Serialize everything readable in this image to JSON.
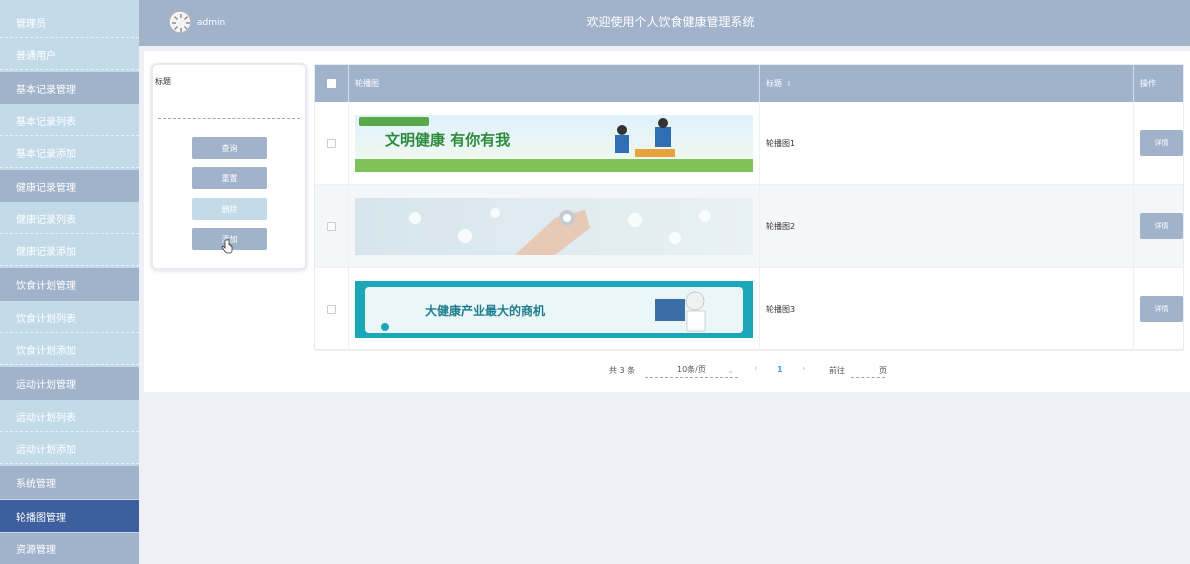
{
  "sidebar": {
    "items": [
      {
        "label": "管理员",
        "kind": "sub"
      },
      {
        "label": "普通用户",
        "kind": "sub"
      },
      {
        "label": "基本记录管理",
        "kind": "header"
      },
      {
        "label": "基本记录列表",
        "kind": "sub"
      },
      {
        "label": "基本记录添加",
        "kind": "sub"
      },
      {
        "label": "健康记录管理",
        "kind": "header"
      },
      {
        "label": "健康记录列表",
        "kind": "sub"
      },
      {
        "label": "健康记录添加",
        "kind": "sub"
      },
      {
        "label": "饮食计划管理",
        "kind": "header"
      },
      {
        "label": "饮食计划列表",
        "kind": "sub"
      },
      {
        "label": "饮食计划添加",
        "kind": "sub"
      },
      {
        "label": "运动计划管理",
        "kind": "header"
      },
      {
        "label": "运动计划列表",
        "kind": "sub"
      },
      {
        "label": "运动计划添加",
        "kind": "sub"
      },
      {
        "label": "系统管理",
        "kind": "header"
      },
      {
        "label": "轮播图管理",
        "kind": "active"
      },
      {
        "label": "资源管理",
        "kind": "header"
      }
    ]
  },
  "header": {
    "username": "admin",
    "title": "欢迎使用个人饮食健康管理系统"
  },
  "search": {
    "label": "标题",
    "value": "",
    "buttons": {
      "query": "查询",
      "reset": "重置",
      "delete": "删除",
      "add": "添加"
    }
  },
  "table": {
    "columns": {
      "image": "轮播图",
      "title": "标题",
      "sort_icon": "⇕",
      "action": "操作"
    },
    "rows": [
      {
        "title": "轮播图1",
        "action": "详情",
        "banner_text": "文明健康 有你有我"
      },
      {
        "title": "轮播图2",
        "action": "详情",
        "banner_text": ""
      },
      {
        "title": "轮播图3",
        "action": "详情",
        "banner_text": "大健康产业最大的商机"
      }
    ]
  },
  "pagination": {
    "total": "共 3 条",
    "page_size": "10条/页",
    "prev": "‹",
    "current": "1",
    "next": "›",
    "goto_label": "前往",
    "goto_value": "",
    "unit": "页"
  },
  "colors": {
    "sidebar_bg": "#c3dbe9",
    "header_bg": "#a1b2cb",
    "active_bg": "#3e5f9e",
    "accent": "#409eff"
  }
}
